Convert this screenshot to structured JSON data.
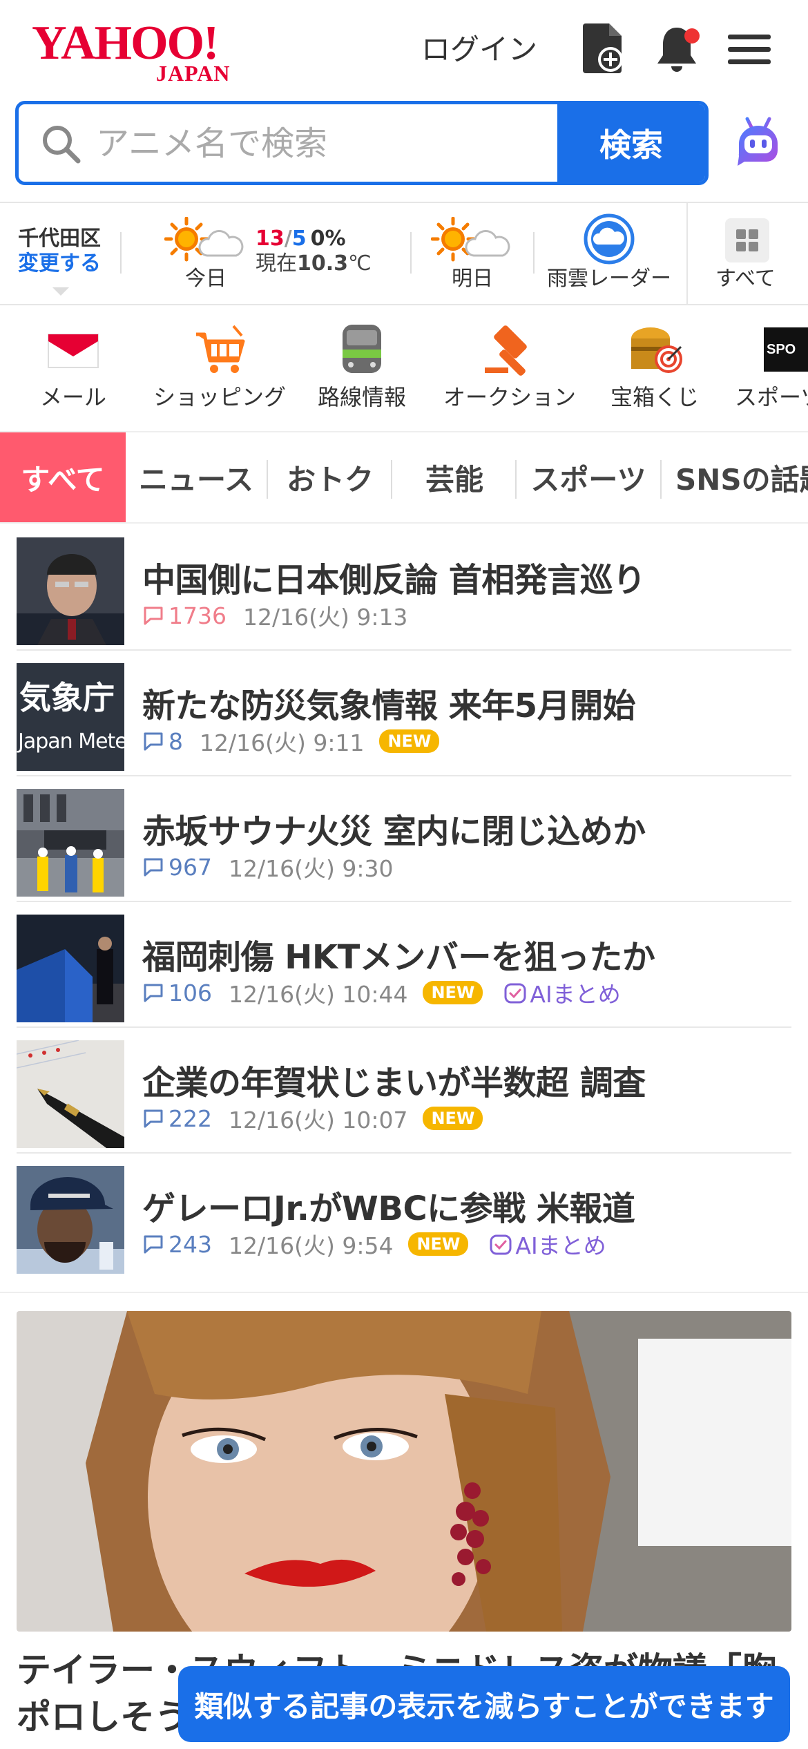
{
  "header": {
    "logo_main": "YAHOO!",
    "logo_sub": "JAPAN",
    "login_label": "ログイン",
    "notification_dot": "#ee3333"
  },
  "search": {
    "placeholder": "アニメ名で検索",
    "button_label": "検索"
  },
  "weather": {
    "area": "千代田区",
    "change_label": "変更する",
    "today_label": "今日",
    "temp_high": "13",
    "temp_sep": "/",
    "temp_low": "5",
    "rain": "0%",
    "now_prefix": "現在",
    "now_temp": "10.3",
    "now_unit": "℃",
    "tomorrow_label": "明日",
    "radar_label": "雨雲レーダー",
    "all_label": "すべて"
  },
  "services": [
    {
      "label": "メール",
      "icon": "mail-icon"
    },
    {
      "label": "ショッピング",
      "icon": "shopping-cart-icon"
    },
    {
      "label": "路線情報",
      "icon": "train-icon"
    },
    {
      "label": "オークション",
      "icon": "auction-hammer-icon"
    },
    {
      "label": "宝箱くじ",
      "icon": "treasure-box-icon"
    },
    {
      "label": "スポーツ",
      "icon": "sports-icon"
    }
  ],
  "tabs": [
    {
      "label": "すべて",
      "active": true
    },
    {
      "label": "ニュース"
    },
    {
      "label": "おトク"
    },
    {
      "label": "芸能"
    },
    {
      "label": "スポーツ"
    },
    {
      "label": "SNSの話題"
    }
  ],
  "news": [
    {
      "title": "中国側に日本側反論 首相発言巡り",
      "comments": "1736",
      "time": "12/16(火) 9:13",
      "hot": true
    },
    {
      "title": "新たな防災気象情報 来年5月開始",
      "comments": "8",
      "time": "12/16(火) 9:11",
      "new": "NEW",
      "thumb_text1": "気象庁",
      "thumb_text2": "Japan Meteo"
    },
    {
      "title": "赤坂サウナ火災 室内に閉じ込めか",
      "comments": "967",
      "time": "12/16(火) 9:30"
    },
    {
      "title": "福岡刺傷 HKTメンバーを狙ったか",
      "comments": "106",
      "time": "12/16(火) 10:44",
      "new": "NEW",
      "ai": "AIまとめ"
    },
    {
      "title": "企業の年賀状じまいが半数超 調査",
      "comments": "222",
      "time": "12/16(火) 10:07",
      "new": "NEW"
    },
    {
      "title": "ゲレーロJr.がWBCに参戦 米報道",
      "comments": "243",
      "time": "12/16(火) 9:54",
      "new": "NEW",
      "ai": "AIまとめ"
    }
  ],
  "feature": {
    "title": "テイラー・スウィフト　ミニドレス姿が物議「胸ポロしそう」"
  },
  "toast": {
    "message": "類似する記事の表示を減らすことができます"
  }
}
